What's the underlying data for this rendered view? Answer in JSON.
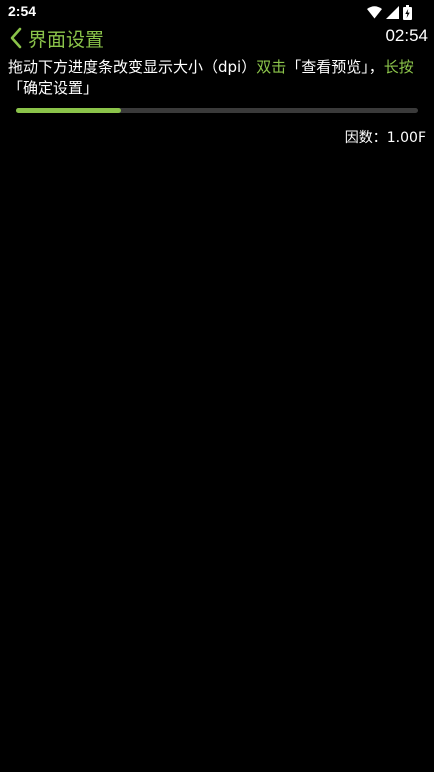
{
  "status_bar": {
    "time": "2:54",
    "icons": [
      "wifi-icon",
      "signal-icon",
      "battery-icon"
    ]
  },
  "app_bar": {
    "back_icon": "chevron-left-icon",
    "title": "界面设置",
    "clock": "02:54"
  },
  "instruction": {
    "part1": "拖动下方进度条改变显示大小（dpi）",
    "double_tap": "双击",
    "part2": "「查看预览」，",
    "long_press": "长按",
    "part3": "「确定设置」"
  },
  "slider": {
    "progress": 0.26
  },
  "factor": {
    "label": "因数：",
    "value": "1.00F"
  },
  "colors": {
    "accent": "#8BC34A",
    "background": "#000000",
    "track": "#3a3a3a",
    "text": "#ffffff"
  }
}
